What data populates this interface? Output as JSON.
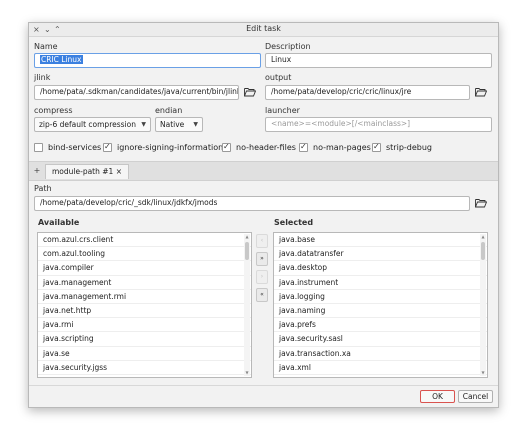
{
  "window": {
    "title": "Edit task",
    "controls": [
      "×",
      "⌄",
      "⌃"
    ]
  },
  "name": {
    "label": "Name",
    "value": "CRIC Linux"
  },
  "description": {
    "label": "Description",
    "value": "Linux"
  },
  "jlink": {
    "label": "jlink",
    "value": "/home/pata/.sdkman/candidates/java/current/bin/jlink"
  },
  "output": {
    "label": "output",
    "value": "/home/pata/develop/cric/cric/linux/jre"
  },
  "compress": {
    "label": "compress",
    "value": "zip-6 default compression"
  },
  "endian": {
    "label": "endian",
    "value": "Native"
  },
  "launcher": {
    "label": "launcher",
    "placeholder": "<name>=<module>[/<mainclass>]"
  },
  "options": [
    {
      "label": "bind-services",
      "checked": false
    },
    {
      "label": "ignore-signing-information",
      "checked": true
    },
    {
      "label": "no-header-files",
      "checked": true
    },
    {
      "label": "no-man-pages",
      "checked": true
    },
    {
      "label": "strip-debug",
      "checked": true
    }
  ],
  "tabs": {
    "add_label": "+",
    "items": [
      {
        "label": "module-path #1 ×"
      }
    ]
  },
  "path": {
    "label": "Path",
    "value": "/home/pata/develop/cric/_sdk/linux/jdkfx/jmods"
  },
  "available": {
    "header": "Available",
    "items": [
      "com.azul.crs.client",
      "com.azul.tooling",
      "java.compiler",
      "java.management",
      "java.management.rmi",
      "java.net.http",
      "java.rmi",
      "java.scripting",
      "java.se",
      "java.security.jgss"
    ]
  },
  "selected": {
    "header": "Selected",
    "items": [
      "java.base",
      "java.datatransfer",
      "java.desktop",
      "java.instrument",
      "java.logging",
      "java.naming",
      "java.prefs",
      "java.security.sasl",
      "java.transaction.xa",
      "java.xml"
    ]
  },
  "move_buttons": [
    "‹",
    "»",
    "›",
    "«"
  ],
  "footer": {
    "ok_label": "OK",
    "cancel_label": "Cancel"
  },
  "colors": {
    "selection": "#3b80e0",
    "default_button_border": "#d9534f"
  }
}
